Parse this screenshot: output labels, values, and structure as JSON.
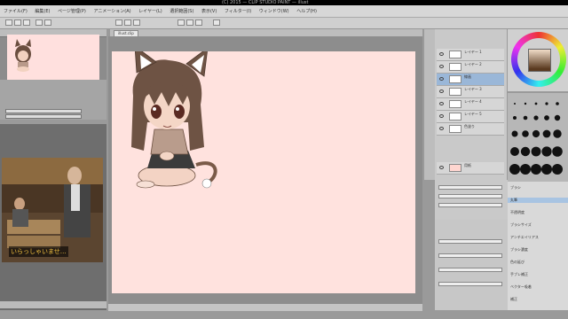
{
  "window": {
    "title": "(C) 2015 — CLIP STUDIO PAINT — illust"
  },
  "menu": [
    "ファイル(F)",
    "編集(E)",
    "ページ管理(P)",
    "アニメーション(A)",
    "レイヤー(L)",
    "選択範囲(S)",
    "表示(V)",
    "フィルター(I)",
    "ウィンドウ(W)",
    "ヘルプ(H)"
  ],
  "canvas_tab": {
    "label": "illust.clip"
  },
  "reference": {
    "subtitle": "いらっしゃいませ…"
  },
  "layers": [
    {
      "label": "レイヤー 1"
    },
    {
      "label": "レイヤー 2"
    },
    {
      "label": "線画"
    },
    {
      "label": "レイヤー 3"
    },
    {
      "label": "レイヤー 4"
    },
    {
      "label": "レイヤー 5"
    },
    {
      "label": "色塗り"
    },
    {
      "label": "用紙"
    }
  ],
  "props": [
    "ブラシ",
    "丸筆",
    "不透明度",
    "ブラシサイズ",
    "アンチエイリアス",
    "ブラシ濃度",
    "色の延び",
    "手ブレ補正",
    "ベクター吸着",
    "補正"
  ],
  "colors": {
    "canvas": "#ffe2de",
    "selection": "#9ab7d8"
  }
}
